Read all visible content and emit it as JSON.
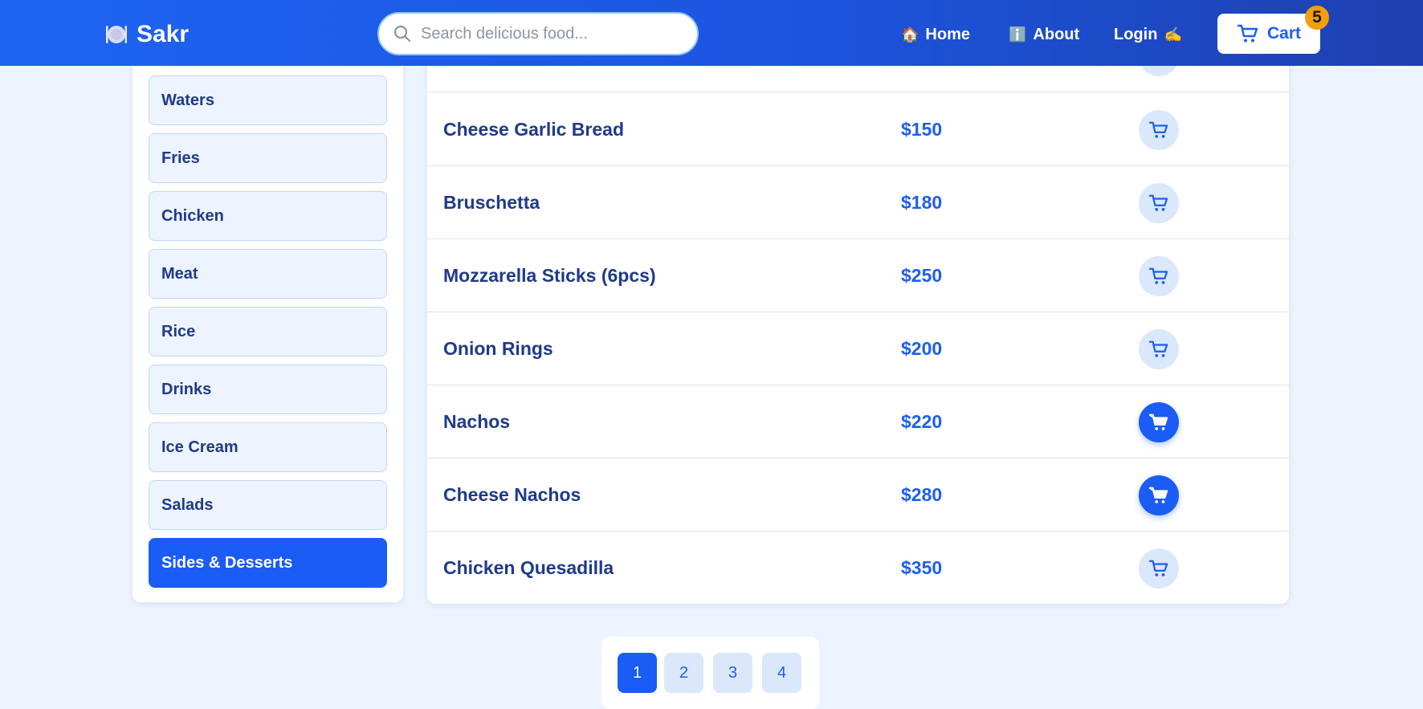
{
  "brand": {
    "name": "Sakr",
    "logo_icon": "plate-icon"
  },
  "search": {
    "placeholder": "Search delicious food..."
  },
  "nav": {
    "home": {
      "emoji": "🏠",
      "label": "Home"
    },
    "about": {
      "emoji": "ℹ️",
      "label": "About"
    },
    "login": {
      "label": "Login",
      "emoji": "✍️"
    }
  },
  "cart": {
    "label": "Cart",
    "count": "5"
  },
  "categories": [
    {
      "label": "Waters",
      "active": false
    },
    {
      "label": "Fries",
      "active": false
    },
    {
      "label": "Chicken",
      "active": false
    },
    {
      "label": "Meat",
      "active": false
    },
    {
      "label": "Rice",
      "active": false
    },
    {
      "label": "Drinks",
      "active": false
    },
    {
      "label": "Ice Cream",
      "active": false
    },
    {
      "label": "Salads",
      "active": false
    },
    {
      "label": "Sides & Desserts",
      "active": true
    }
  ],
  "items": [
    {
      "name": "Cheese Garlic Bread",
      "price": "$150",
      "in_cart": false
    },
    {
      "name": "Bruschetta",
      "price": "$180",
      "in_cart": false
    },
    {
      "name": "Mozzarella Sticks (6pcs)",
      "price": "$250",
      "in_cart": false
    },
    {
      "name": "Onion Rings",
      "price": "$200",
      "in_cart": false
    },
    {
      "name": "Nachos",
      "price": "$220",
      "in_cart": true
    },
    {
      "name": "Cheese Nachos",
      "price": "$280",
      "in_cart": true
    },
    {
      "name": "Chicken Quesadilla",
      "price": "$350",
      "in_cart": false
    }
  ],
  "pagination": {
    "pages": [
      "1",
      "2",
      "3",
      "4"
    ],
    "current": "1"
  },
  "colors": {
    "primary": "#1a5cf5",
    "text": "#1e3a8a",
    "badge": "#f59e0b",
    "background": "#edf4ff"
  }
}
